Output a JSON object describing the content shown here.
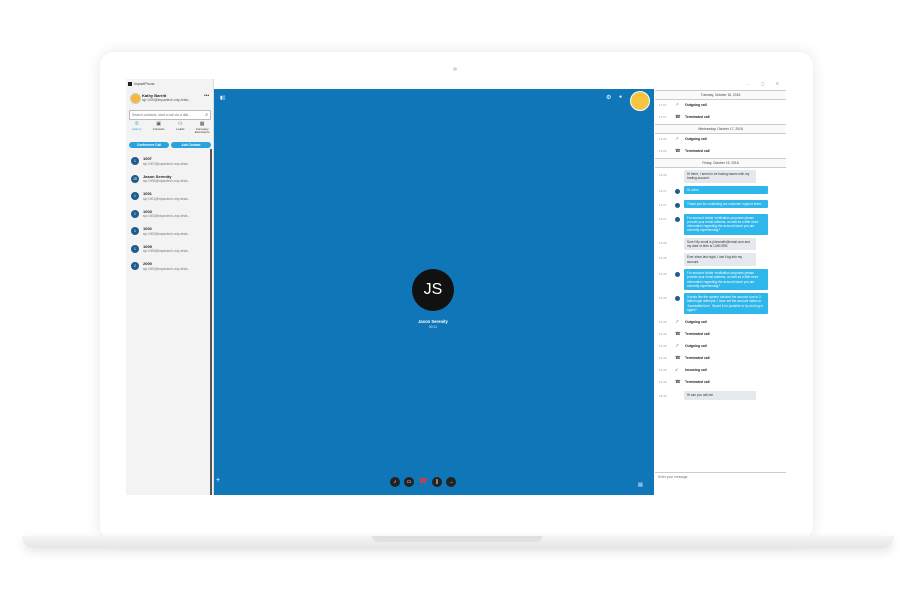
{
  "app": {
    "title": "ImpactPhone"
  },
  "user": {
    "name": "Kathy Barritt",
    "sip": "sip:1000@impactech-voip-tests..."
  },
  "search": {
    "placeholder": "Search contacts, start a call via a dial..."
  },
  "nav": [
    {
      "label": "History",
      "icon": "phone-icon",
      "active": true
    },
    {
      "label": "Contacts",
      "icon": "contacts-icon",
      "active": false
    },
    {
      "label": "Leads",
      "icon": "leads-icon",
      "active": false
    },
    {
      "label": "Company Extensions",
      "icon": "building-icon",
      "active": false
    }
  ],
  "buttons": {
    "conference": "Conference Call",
    "add_contact": "Add Contact"
  },
  "contacts": [
    {
      "initial": "1",
      "name": "1007",
      "sip": "sip:1007@impactech-voip-tests..."
    },
    {
      "initial": "JS",
      "name": "Jason Serenity",
      "sip": "sip:1005@impactech-voip-tests..."
    },
    {
      "initial": "1",
      "name": "1001",
      "sip": "sip:1001@impactech-voip-tests..."
    },
    {
      "initial": "1",
      "name": "1003",
      "sip": "sip:1003@impactech-voip-tests..."
    },
    {
      "initial": "1",
      "name": "1002",
      "sip": "sip:1002@impactech-voip-tests..."
    },
    {
      "initial": "1",
      "name": "1009",
      "sip": "sip:1009@impactech-voip-tests..."
    },
    {
      "initial": "2",
      "name": "2000",
      "sip": "sip:2000@impactech-voip-tests..."
    }
  ],
  "call": {
    "initials": "JS",
    "name": "Jason Serenity",
    "duration": "00:11"
  },
  "colors": {
    "call_bg": "#0f77b8",
    "accent": "#29a3dc",
    "end_call": "#e53935"
  },
  "history": {
    "day1": {
      "date": "Tuesday, October 16, 2018",
      "rows": [
        {
          "time": "17:07",
          "label": "Outgoing call",
          "icon": "outgoing-arrow-icon"
        },
        {
          "time": "17:07",
          "label": "Terminated call",
          "icon": "terminated-phone-icon"
        }
      ]
    },
    "day2": {
      "date": "Wednesday, October 17, 2018",
      "rows": [
        {
          "time": "13:03",
          "label": "Outgoing call",
          "icon": "outgoing-arrow-icon"
        },
        {
          "time": "13:03",
          "label": "Terminated call",
          "icon": "terminated-phone-icon"
        }
      ]
    },
    "day3": {
      "date": "Friday, October 19, 2018",
      "messages": [
        {
          "time": "14:36",
          "dir": "in",
          "text": "Hi there, I seem to be having issues with my trading account."
        },
        {
          "time": "14:37",
          "dir": "out",
          "text": "Hi John!"
        },
        {
          "time": "14:37",
          "dir": "out",
          "text": "Thank you for contacting our customer support team."
        },
        {
          "time": "14:37",
          "dir": "out",
          "text": "For account holder verification purposes please provide your email address, as well as a little more information regarding the account issue you are currently experiencing?"
        },
        {
          "time": "14:38",
          "dir": "in",
          "text": "Sure! My email is johnsmith@email.com and my date of birth is 12/8/1995."
        },
        {
          "time": "14:38",
          "dir": "in",
          "text": "Ever since last night, I can't log into my account."
        },
        {
          "time": "14:39",
          "dir": "out",
          "text": "For account holder verification purposes please provide your email address, as well as a little more information regarding the account issue you are currently experiencing?"
        },
        {
          "time": "14:39",
          "dir": "out",
          "text": "It looks like the system blocked the account due to 3 failed login attempts. I have set the account status to 'Accessible/Live'. Would it be possible to try and log in again?"
        }
      ],
      "rows": [
        {
          "time": "14:39",
          "label": "Outgoing call",
          "icon": "outgoing-arrow-icon"
        },
        {
          "time": "14:39",
          "label": "Terminated call",
          "icon": "terminated-phone-icon"
        },
        {
          "time": "14:39",
          "label": "Outgoing call",
          "icon": "outgoing-arrow-icon"
        },
        {
          "time": "14:39",
          "label": "Terminated call",
          "icon": "terminated-phone-icon"
        },
        {
          "time": "14:39",
          "label": "Incoming call",
          "icon": "incoming-arrow-icon"
        },
        {
          "time": "14:39",
          "label": "Terminated call",
          "icon": "terminated-phone-icon"
        }
      ],
      "last": {
        "time": "14:40",
        "dir": "in",
        "text": "Hi can you call me"
      }
    }
  },
  "composer": {
    "placeholder": "Enter your message"
  }
}
